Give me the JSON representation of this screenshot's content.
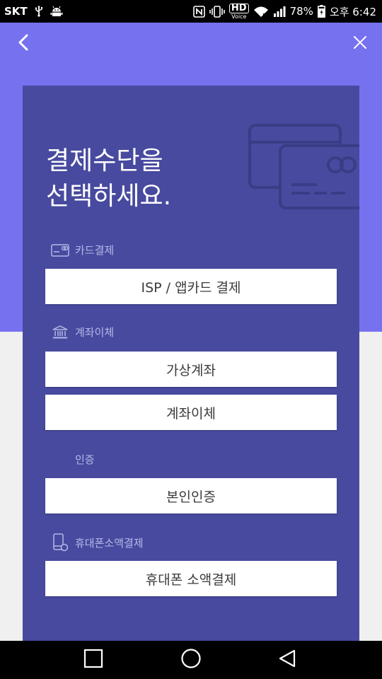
{
  "status_bar": {
    "carrier": "SKT",
    "hd_label": "HD",
    "voice_label": "Voice",
    "battery": "78%",
    "time": "오후 6:42",
    "icons": [
      "usb-icon",
      "android-debug-icon",
      "nfc-icon",
      "vibrate-icon",
      "wifi-icon",
      "signal-icon",
      "battery-icon"
    ]
  },
  "header": {
    "back_icon": "chevron-left-icon",
    "close_icon": "close-icon"
  },
  "panel": {
    "title": "결제수단을\n선택하세요."
  },
  "sections": {
    "card": {
      "label": "카드결제",
      "icon": "credit-card-icon",
      "buttons": [
        "ISP / 앱카드 결제"
      ]
    },
    "bank": {
      "label": "계좌이체",
      "icon": "bank-icon",
      "buttons": [
        "가상계좌",
        "계좌이체"
      ]
    },
    "auth": {
      "label": "인증",
      "buttons": [
        "본인인증"
      ]
    },
    "phone": {
      "label": "휴대폰소액결제",
      "icon": "mobile-phone-icon",
      "buttons": [
        "휴대폰 소액결제"
      ]
    }
  },
  "colors": {
    "header_bg": "#7672ef",
    "panel_bg": "#484a9f",
    "page_bg": "#f0f0f0",
    "label_color": "#b5b8e6"
  },
  "nav_bar": {
    "icons": [
      "recent-apps-icon",
      "home-icon",
      "back-triangle-icon"
    ]
  }
}
